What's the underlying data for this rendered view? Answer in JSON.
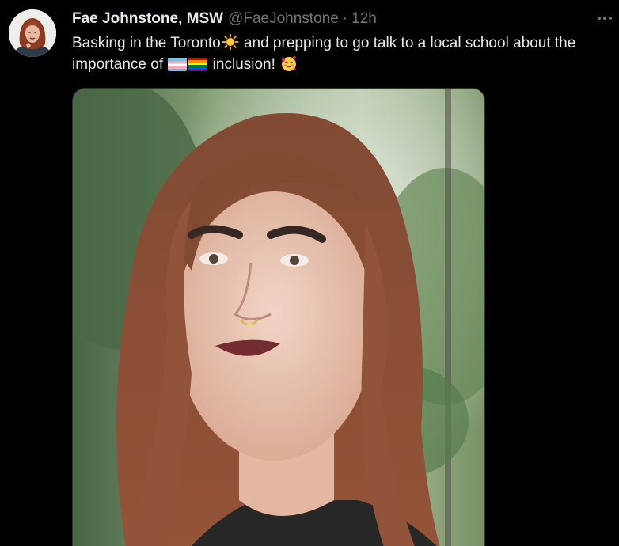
{
  "tweet": {
    "author": {
      "display_name": "Fae Johnstone, MSW",
      "handle": "@FaeJohnstone",
      "separator": "·",
      "time": "12h"
    },
    "more_label": "···",
    "text": {
      "part1": "Basking in the Toronto",
      "part2": " and prepping to go talk to a local school about the importance of ",
      "part3": " inclusion! "
    },
    "icons": {
      "sun": "sun-emoji",
      "trans_flag": "transgender-flag-emoji",
      "rainbow_flag": "rainbow-flag-emoji",
      "hugging_face": "smiling-face-with-hearts-emoji",
      "more": "more-options-icon"
    },
    "colors": {
      "background": "#000000",
      "primary_text": "#e7e9ea",
      "secondary_text": "#71767b"
    }
  }
}
